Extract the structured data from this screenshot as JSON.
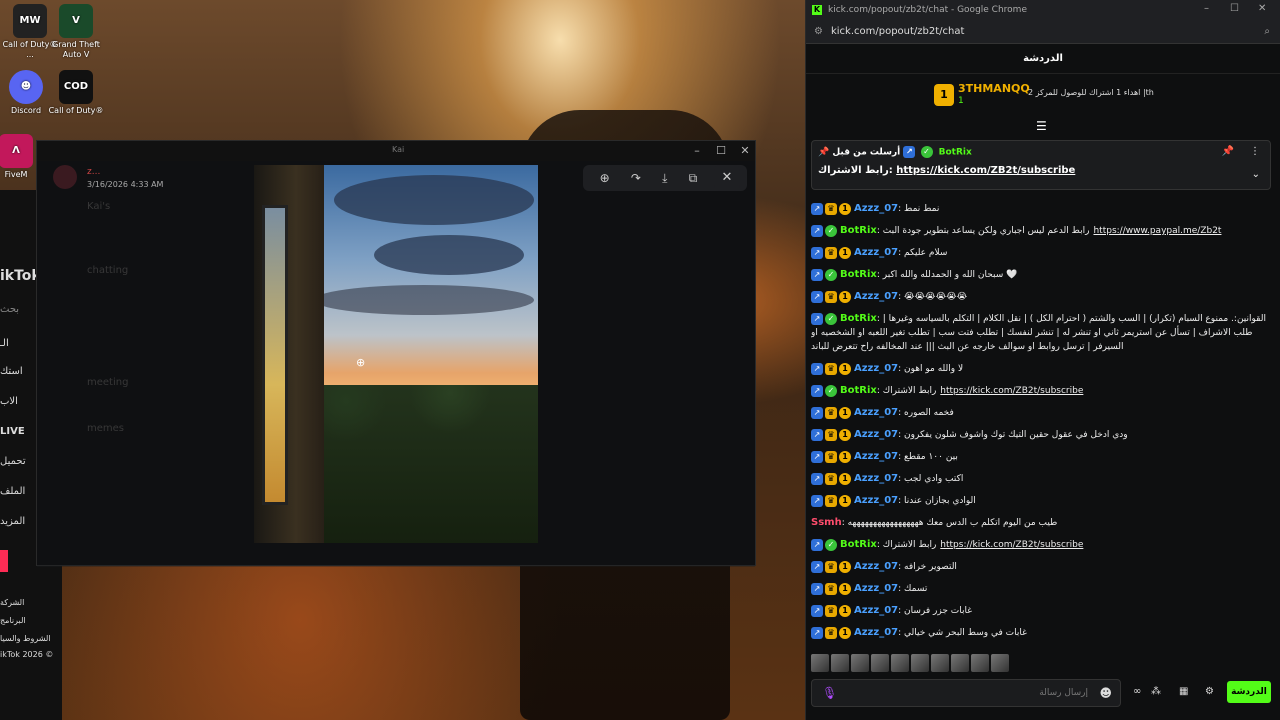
{
  "desktop": {
    "icons": [
      {
        "label": "Call of Duty® ...",
        "glyph": "MW",
        "color": "#222222"
      },
      {
        "label": "Grand Theft Auto V",
        "glyph": "V",
        "color": "#1a4a2a"
      },
      {
        "label": "Discord",
        "glyph": "☻",
        "color": "#5865f2"
      },
      {
        "label": "Call of Duty®",
        "glyph": "COD",
        "color": "#111111"
      },
      {
        "label": "FiveM",
        "glyph": "Λ",
        "color": "#c2185b"
      }
    ]
  },
  "left_browser": {
    "rows": [
      "ikTok",
      "بحث",
      "الـ",
      "استك",
      "الاب",
      "LIVE",
      "تحميل",
      "الملف",
      "المزيد",
      "الشركة",
      "البرنامج",
      "الشروط والسيا",
      "ikTok 2026 ©"
    ]
  },
  "viewer": {
    "username": "z...",
    "timestamp": "3/16/2026 4:33 AM",
    "channels": [
      "chatting",
      "memes",
      "meeting",
      "Kai's"
    ],
    "toolbar_icons": [
      "zoom-icon",
      "share-icon",
      "download-icon",
      "open-external-icon",
      "more-icon"
    ],
    "window_title": "Kai"
  },
  "chat": {
    "window_title": "kick.com/popout/zb2t/chat - Google Chrome",
    "url": "kick.com/popout/zb2t/chat",
    "header": "الدردشة",
    "gifter": {
      "name": "3THMANQQ",
      "count": "1",
      "text": "اهداء 1 اشتراك للوصول للمركز 2 |th"
    },
    "pinned": {
      "prefix": "أرسلت من قبل",
      "by": "BotRix",
      "text": "رابط الاشتراك:",
      "link": "https://kick.com/ZB2t/subscribe"
    },
    "messages": [
      {
        "user": "Azzz_07",
        "color": "#4aa0ff",
        "badges": [
          "sub",
          "vip",
          "lvl"
        ],
        "text": ": نمط نمط"
      },
      {
        "user": "BotRix",
        "color": "#53fc18",
        "badges": [
          "sub",
          "ver"
        ],
        "text": ": رابط الدعم ليس اجباري ولكن يساعد بتطوير جودة البث",
        "link": "https://www.paypal.me/Zb2t"
      },
      {
        "user": "Azzz_07",
        "color": "#4aa0ff",
        "badges": [
          "sub",
          "vip",
          "lvl"
        ],
        "text": ": سلام عليكم"
      },
      {
        "user": "BotRix",
        "color": "#53fc18",
        "badges": [
          "sub",
          "ver"
        ],
        "text": ": سبحان الله و الحمدلله والله اكبر 🤍"
      },
      {
        "user": "Azzz_07",
        "color": "#4aa0ff",
        "badges": [
          "sub",
          "vip",
          "lvl"
        ],
        "text": ": 😭😭😭😭😭😭"
      },
      {
        "user": "BotRix",
        "color": "#53fc18",
        "badges": [
          "sub",
          "ver"
        ],
        "multi": true,
        "text": ": القوانين:. ممنوع السبام (تكرار) | السب والشتم ( احترام الكل ) | نقل الكلام | التكلم بالسياسه وغيرها | طلب الاشراف | تسأل عن استريمر ثاني او تنشر له | تنشر لنفسك | تطلب فتت سب | تطلب تغير اللعبه او الشخصيه او السيرفر | ترسل روابط او سوالف خارجه عن البث ||| عند المخالفه راح تتعرض للباند"
      },
      {
        "user": "Azzz_07",
        "color": "#4aa0ff",
        "badges": [
          "sub",
          "vip",
          "lvl"
        ],
        "text": ": لا والله مو اهون"
      },
      {
        "user": "BotRix",
        "color": "#53fc18",
        "badges": [
          "sub",
          "ver"
        ],
        "text": ": رابط الاشتراك",
        "link": "https://kick.com/ZB2t/subscribe"
      },
      {
        "user": "Azzz_07",
        "color": "#4aa0ff",
        "badges": [
          "sub",
          "vip",
          "lvl"
        ],
        "text": ": فخمه الصوره"
      },
      {
        "user": "Azzz_07",
        "color": "#4aa0ff",
        "badges": [
          "sub",
          "vip",
          "lvl"
        ],
        "text": ": ودي ادخل في عقول حقين التيك توك واشوف شلون يفكرون"
      },
      {
        "user": "Azzz_07",
        "color": "#4aa0ff",
        "badges": [
          "sub",
          "vip",
          "lvl"
        ],
        "text": ": بين ١٠٠ مقطع"
      },
      {
        "user": "Azzz_07",
        "color": "#4aa0ff",
        "badges": [
          "sub",
          "vip",
          "lvl"
        ],
        "text": ": اكتب وادي لجب"
      },
      {
        "user": "Azzz_07",
        "color": "#4aa0ff",
        "badges": [
          "sub",
          "vip",
          "lvl"
        ],
        "text": ": الوادي بجازان عندنا"
      },
      {
        "user": "Ssmh",
        "color": "#ff4d6d",
        "badges": [],
        "text": ": طيب من اليوم اتكلم ب الدس معك هههههههههههههههههه"
      },
      {
        "user": "BotRix",
        "color": "#53fc18",
        "badges": [
          "sub",
          "ver"
        ],
        "text": ": رابط الاشتراك",
        "link": "https://kick.com/ZB2t/subscribe"
      },
      {
        "user": "Azzz_07",
        "color": "#4aa0ff",
        "badges": [
          "sub",
          "vip",
          "lvl"
        ],
        "text": ": التصوير خرافه"
      },
      {
        "user": "Azzz_07",
        "color": "#4aa0ff",
        "badges": [
          "sub",
          "vip",
          "lvl"
        ],
        "text": ": تسمك"
      },
      {
        "user": "Azzz_07",
        "color": "#4aa0ff",
        "badges": [
          "sub",
          "vip",
          "lvl"
        ],
        "text": ": غابات جزر فرسان"
      },
      {
        "user": "Azzz_07",
        "color": "#4aa0ff",
        "badges": [
          "sub",
          "vip",
          "lvl"
        ],
        "text": ": غابات في وسط البحر شي خيالي"
      }
    ],
    "input_placeholder": "إرسال رسالة",
    "send_label": "الدردشة"
  }
}
